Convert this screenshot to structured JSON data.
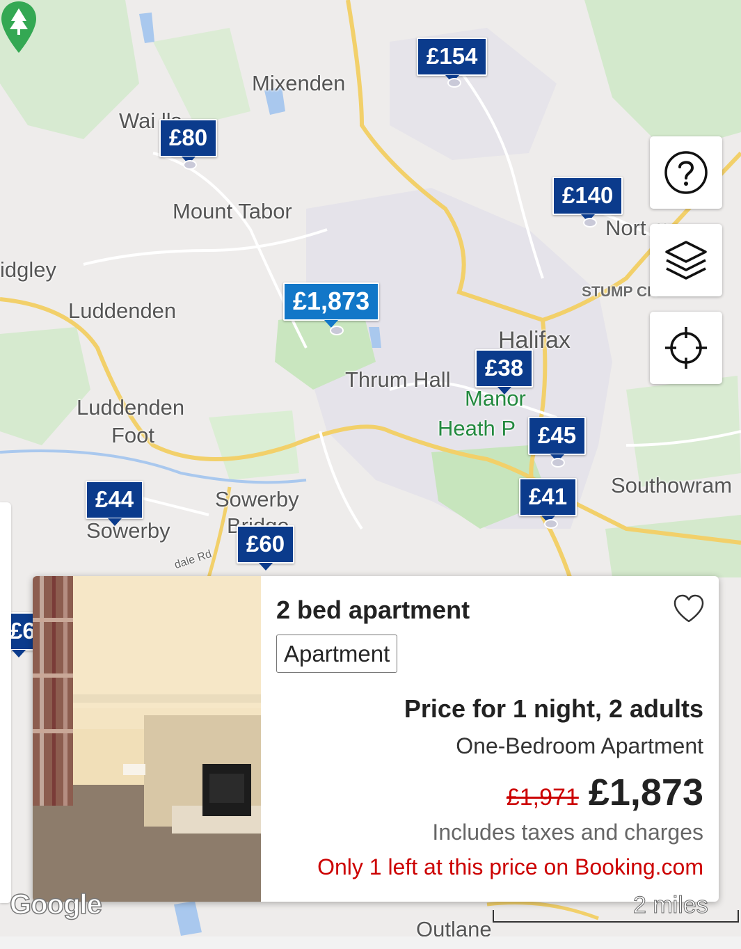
{
  "places": [
    {
      "id": "mixenden",
      "text": "Mixenden",
      "style": ""
    },
    {
      "id": "wainstalls",
      "text": "Wai       lls",
      "style": ""
    },
    {
      "id": "mount-tabor",
      "text": "Mount Tabor",
      "style": ""
    },
    {
      "id": "midgley",
      "text": "idgley",
      "style": ""
    },
    {
      "id": "luddenden",
      "text": "Luddenden",
      "style": ""
    },
    {
      "id": "luddenden-foot-1",
      "text": "Luddenden",
      "style": ""
    },
    {
      "id": "luddenden-foot-2",
      "text": "Foot",
      "style": ""
    },
    {
      "id": "thrum-hall",
      "text": "Thrum Hall",
      "style": ""
    },
    {
      "id": "halifax",
      "text": "Halifax",
      "style": ""
    },
    {
      "id": "manor-heath-1",
      "text": "Manor",
      "style": "green"
    },
    {
      "id": "manor-heath-2",
      "text": "Heath P",
      "style": "green"
    },
    {
      "id": "northowram",
      "text": "Nort       m",
      "style": ""
    },
    {
      "id": "stump-cross",
      "text": "STUMP CR",
      "style": "small"
    },
    {
      "id": "southowram",
      "text": "Southowram",
      "style": ""
    },
    {
      "id": "sowerby-bridge-1",
      "text": "Sowerby",
      "style": ""
    },
    {
      "id": "sowerby-bridge-2",
      "text": "Bridge",
      "style": ""
    },
    {
      "id": "sowerby",
      "text": "Sowerby",
      "style": ""
    },
    {
      "id": "road-dale",
      "text": "dale Rd",
      "style": "road"
    },
    {
      "id": "outlane",
      "text": "Outlane",
      "style": ""
    }
  ],
  "markers": [
    {
      "id": "marker-154",
      "price": "£154",
      "selected": false
    },
    {
      "id": "marker-80",
      "price": "£80",
      "selected": false
    },
    {
      "id": "marker-140",
      "price": "£140",
      "selected": false
    },
    {
      "id": "marker-1873",
      "price": "£1,873",
      "selected": true
    },
    {
      "id": "marker-38",
      "price": "£38",
      "selected": false
    },
    {
      "id": "marker-45",
      "price": "£45",
      "selected": false
    },
    {
      "id": "marker-41",
      "price": "£41",
      "selected": false
    },
    {
      "id": "marker-44",
      "price": "£44",
      "selected": false
    },
    {
      "id": "marker-60",
      "price": "£60",
      "selected": false
    },
    {
      "id": "marker-partial",
      "price": "£6",
      "selected": false
    }
  ],
  "controls": {
    "help": "help-icon",
    "layers": "layers-icon",
    "locate": "locate-icon"
  },
  "card": {
    "title": "2 bed apartment",
    "tag": "Apartment",
    "price_label": "Price for 1 night, 2 adults",
    "room_type": "One-Bedroom Apartment",
    "old_price": "£1,971",
    "new_price": "£1,873",
    "taxes": "Includes taxes and charges",
    "availability": "Only 1 left at this price on Booking.com",
    "favorite_icon": "heart-icon"
  },
  "attribution": {
    "logo": "Google",
    "scale": "2 miles"
  },
  "colors": {
    "marker": "#0b3b8c",
    "marker_selected": "#1277c8",
    "alert": "#cc0000",
    "park_green": "#23893f"
  }
}
